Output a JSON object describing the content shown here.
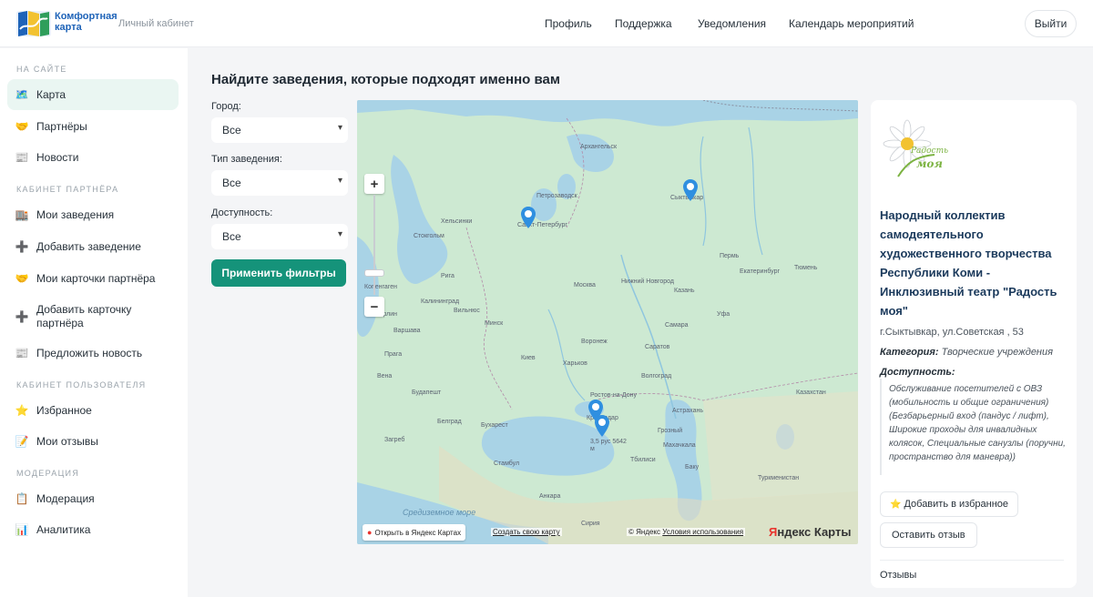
{
  "header": {
    "brand_line1": "Комфортная",
    "brand_line2": "карта",
    "cabinet_label": "Личный кабинет",
    "nav": [
      "Профиль",
      "Поддержка",
      "Уведомления",
      "Календарь мероприятий"
    ],
    "logout": "Выйти"
  },
  "sidebar": {
    "sections": [
      "На сайте",
      "Кабинет партнёра",
      "Кабинет пользователя",
      "Модерация"
    ],
    "items": [
      {
        "label": "Карта",
        "icon": "🗺️"
      },
      {
        "label": "Партнёры",
        "icon": "🤝"
      },
      {
        "label": "Новости",
        "icon": "📰"
      },
      {
        "label": "Мои заведения",
        "icon": "🏬"
      },
      {
        "label": "Добавить заведение",
        "icon": "➕"
      },
      {
        "label": "Мои карточки партнёра",
        "icon": "🤝"
      },
      {
        "label": "Добавить карточку партнёра",
        "icon": "➕"
      },
      {
        "label": "Предложить новость",
        "icon": "📰"
      },
      {
        "label": "Избранное",
        "icon": "⭐"
      },
      {
        "label": "Мои отзывы",
        "icon": "📝"
      },
      {
        "label": "Модерация",
        "icon": "📋"
      },
      {
        "label": "Аналитика",
        "icon": "📊"
      }
    ]
  },
  "main": {
    "title": "Найдите заведения, которые подходят именно вам",
    "filters": [
      {
        "label": "Город:",
        "value": "Все"
      },
      {
        "label": "Тип заведения:",
        "value": "Все"
      },
      {
        "label": "Доступность:",
        "value": "Все"
      }
    ],
    "apply_button": "Применить фильтры"
  },
  "map": {
    "labels": [
      "Хельсинки",
      "Стокгольм",
      "Петрозаводск",
      "Архангельск",
      "Санкт-Петербург",
      "Сыктывкар",
      "Пермь",
      "Тюмень",
      "Екатеринбург",
      "Калининград",
      "Рига",
      "Вильнюс",
      "Минск",
      "Москва",
      "Нижний Новгород",
      "Казань",
      "Самара",
      "Уфа",
      "Варшава",
      "Киев",
      "Воронеж",
      "Саратов",
      "Харьков",
      "Волгоград",
      "Ростов-на-Дону",
      "Астрахань",
      "Будапешт",
      "Белград",
      "Бухарест",
      "Краснодар",
      "Казахстан",
      "Стамбул",
      "Махачкала",
      "Средиземное море",
      "Анкара",
      "Сирия",
      "Туркменистан",
      "Грозный",
      "Баку",
      "Тбилиси",
      "Загреб",
      "Вена",
      "Прага",
      "Берлин",
      "Копенгаген"
    ],
    "pin_caption": "3,5 рус 5642 м",
    "zoom_in": "+",
    "zoom_out": "−",
    "open_in": "Открыть в Яндекс Картах",
    "create_map": "Создать свою карту",
    "copyright": "© Яндекс",
    "terms": "Условия использования",
    "brand_y": "Я",
    "brand_rest": "ндекс Карты"
  },
  "card": {
    "logo_text": "Радость моя",
    "name": "Народный коллектив самодеятельного художественного творчества Республики Коми - Инклюзивный театр \"Радость моя\"",
    "address": "г.Сыктывкар, ул.Советская , 53",
    "category_label": "Категория:",
    "category_value": "Творческие учреждения",
    "accessibility_label": "Доступность:",
    "accessibility_text": "Обслуживание посетителей с ОВЗ (мобильность и общие ограничения) (Безбарьерный вход (пандус / лифт), Широкие проходы для инвалидных колясок, Специальные санузлы (поручни, пространство для маневра))",
    "favorite_button": "Добавить в избранное",
    "review_button": "Оставить отзыв",
    "reviews_label": "Отзывы"
  },
  "colors": {
    "accent": "#15937a",
    "brand": "#1e63b8",
    "active_bg": "#eaf6f2"
  }
}
